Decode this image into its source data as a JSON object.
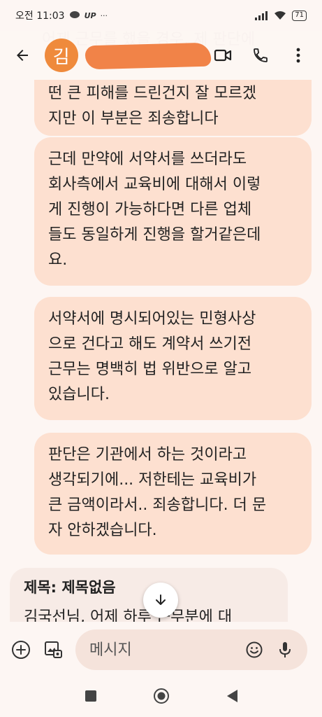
{
  "status_bar": {
    "time": "오전 11:03",
    "indicators": "UP",
    "more": "···",
    "battery": "71"
  },
  "header": {
    "avatar_initial": "김",
    "ghost_text": "어제 근무를 했을 경우, 제 판단에"
  },
  "messages": [
    {
      "text": "떤 큰 피해를 드린건지 잘 모르겠\n지만 이 부분은 죄송합니다"
    },
    {
      "text": "근데 만약에 서약서를 쓰더라도\n회사측에서 교육비에 대해서 이렇\n게 진행이 가능하다면 다른 업체\n들도 동일하게 진행을 할거같은데\n요."
    },
    {
      "text": "서약서에 명시되어있는 민형사상\n으로 건다고 해도 계약서 쓰기전\n근무는 명백히 법 위반으로 알고\n있습니다."
    },
    {
      "text": "판단은 기관에서 하는 것이라고\n생각되기에... 저한테는 교육비가\n큰 금액이라서.. 죄송합니다. 더 문\n자 안하겠습니다."
    }
  ],
  "incoming": {
    "subject": "제목: 제목없음",
    "body": "김국선님, 어제 하루 근무분에 대"
  },
  "composer": {
    "placeholder": "메시지"
  },
  "colors": {
    "bubble_out": "#fde0d0",
    "bubble_in": "#f7ebe6",
    "avatar": "#ef8a3c",
    "background": "#fdf6f3"
  },
  "icons": [
    "back-arrow-icon",
    "video-call-icon",
    "phone-icon",
    "more-vert-icon",
    "scroll-down-icon",
    "add-icon",
    "gallery-icon",
    "emoji-icon",
    "mic-icon",
    "nav-recents-icon",
    "nav-home-icon",
    "nav-back-icon"
  ]
}
